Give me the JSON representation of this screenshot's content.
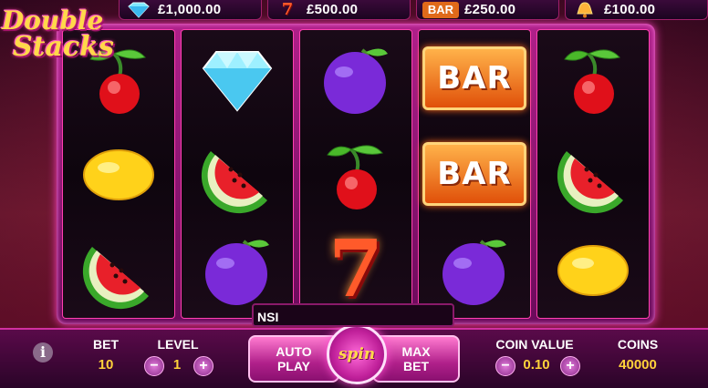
{
  "logo": {
    "line1": "Double",
    "line2": "Stacks"
  },
  "paytable": [
    {
      "icon": "diamond-icon",
      "amount": "£1,000.00"
    },
    {
      "icon": "seven-icon",
      "amount": "£500.00"
    },
    {
      "icon": "bar-icon",
      "icon_text": "BAR",
      "amount": "£250.00"
    },
    {
      "icon": "bell-icon",
      "amount": "£100.00"
    }
  ],
  "reels": [
    [
      "cherry",
      "lemon",
      "watermelon"
    ],
    [
      "diamond",
      "watermelon",
      "plum"
    ],
    [
      "plum",
      "cherry",
      "seven"
    ],
    [
      "bar",
      "bar",
      "plum"
    ],
    [
      "cherry",
      "watermelon",
      "lemon"
    ]
  ],
  "bar_text": "BAR",
  "seven_text": "7",
  "message": "NSI",
  "controls": {
    "info_label": "i",
    "bet_label": "BET",
    "bet_value": "10",
    "level_label": "LEVEL",
    "level_value": "1",
    "minus": "−",
    "plus": "+",
    "auto_play_line1": "AUTO",
    "auto_play_line2": "PLAY",
    "spin_label": "spin",
    "max_bet_line1": "MAX",
    "max_bet_line2": "BET",
    "coin_value_label": "COIN VALUE",
    "coin_value": "0.10",
    "coins_label": "COINS",
    "coins_value": "40000"
  },
  "colors": {
    "accent": "#ff40b0",
    "value_text": "#ffd23a",
    "background": "#4a0a25"
  }
}
